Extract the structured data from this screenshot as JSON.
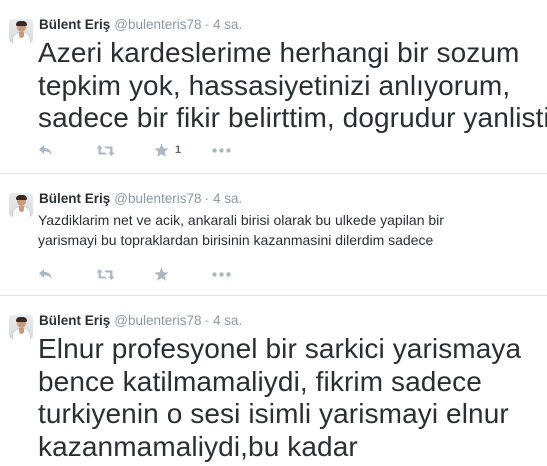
{
  "tweets": [
    {
      "name": "Bülent Eriş",
      "handle": "@bulenteris78",
      "dot": "·",
      "time": "4 sa.",
      "lines": [
        "Azeri kardeslerime herhangi bir sozum",
        "tepkim yok, hassasiyetinizi anlıyorum,",
        "sadece bir fikir belirttim, dogrudur yanlistir,"
      ],
      "favorite_count": "1"
    },
    {
      "name": "Bülent Eriş",
      "handle": "@bulenteris78",
      "dot": "·",
      "time": "4 sa.",
      "lines": [
        "Yazdiklarim net ve acik, ankarali birisi olarak bu ulkede yapilan bir",
        "yarismayi bu topraklardan birisinin kazanmasini dilerdim sadece"
      ],
      "favorite_count": ""
    },
    {
      "name": "Bülent Eriş",
      "handle": "@bulenteris78",
      "dot": "·",
      "time": "4 sa.",
      "lines": [
        "Elnur profesyonel bir sarkici yarismaya",
        "bence katilmamaliydi, fikrim sadece",
        "turkiyenin o sesi isimli yarismayi elnur",
        "kazanmamaliydi,bu kadar"
      ],
      "favorite_count": ""
    }
  ],
  "icons": {
    "reply": "reply-icon",
    "retweet": "retweet-icon",
    "favorite": "star-icon",
    "more": "more-icon"
  },
  "colors": {
    "icon": "#aab8c2",
    "meta": "#8899a6",
    "text": "#292f33",
    "divider": "#e1e8ed"
  }
}
